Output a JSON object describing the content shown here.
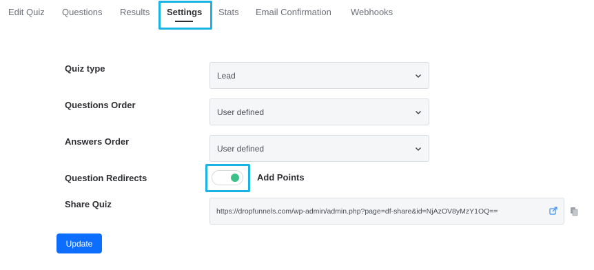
{
  "tabs": [
    {
      "label": "Edit Quiz"
    },
    {
      "label": "Questions"
    },
    {
      "label": "Results"
    },
    {
      "label": "Settings",
      "active": true
    },
    {
      "label": "Stats"
    },
    {
      "label": "Email Confirmation"
    },
    {
      "label": "Webhooks"
    }
  ],
  "form": {
    "quiz_type": {
      "label": "Quiz type",
      "value": "Lead"
    },
    "questions_order": {
      "label": "Questions Order",
      "value": "User defined"
    },
    "answers_order": {
      "label": "Answers Order",
      "value": "User defined"
    },
    "question_redirects": {
      "label": "Question Redirects",
      "toggle_on": true,
      "toggle_label": "Add Points"
    },
    "share_quiz": {
      "label": "Share Quiz",
      "url": "https://dropfunnels.com/wp-admin/admin.php?page=df-share&id=NjAzOV8yMzY1OQ=="
    }
  },
  "actions": {
    "update_label": "Update"
  },
  "colors": {
    "highlight": "#19b4e6",
    "toggle_on": "#3fbf88",
    "primary_button": "#0d6efd"
  },
  "icons": {
    "select_arrow": "chevron-down-icon",
    "share": "external-share-icon",
    "copy": "copy-icon"
  }
}
